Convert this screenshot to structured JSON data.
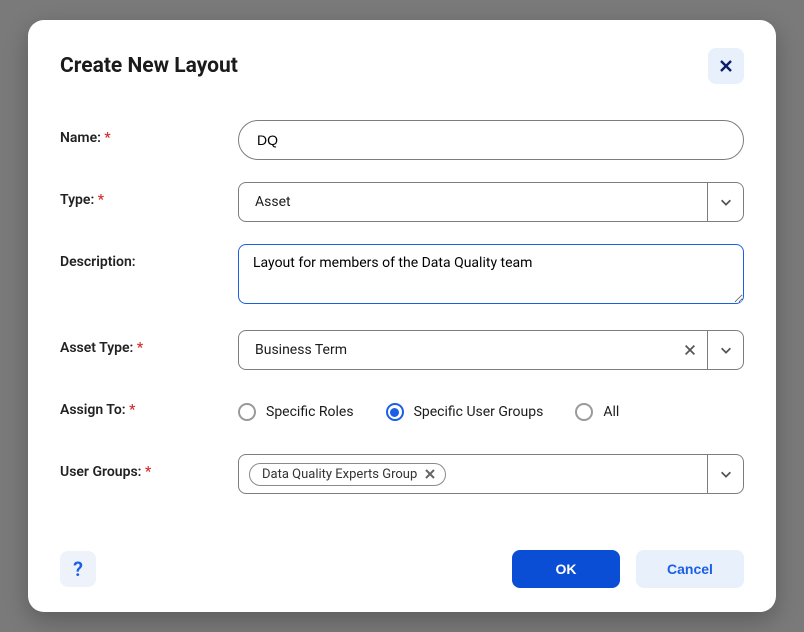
{
  "dialog": {
    "title": "Create New Layout",
    "help_symbol": "?"
  },
  "labels": {
    "name": "Name:",
    "type": "Type:",
    "description": "Description:",
    "asset_type": "Asset Type:",
    "assign_to": "Assign To:",
    "user_groups": "User Groups:"
  },
  "required_marker": "*",
  "form": {
    "name": "DQ",
    "type": "Asset",
    "description": "Layout for members of the Data Quality team",
    "asset_type": "Business Term",
    "assign_to_options": {
      "specific_roles": "Specific Roles",
      "specific_user_groups": "Specific User Groups",
      "all": "All",
      "selected": "specific_user_groups"
    },
    "user_groups": [
      "Data Quality Experts Group"
    ]
  },
  "buttons": {
    "ok": "OK",
    "cancel": "Cancel"
  }
}
